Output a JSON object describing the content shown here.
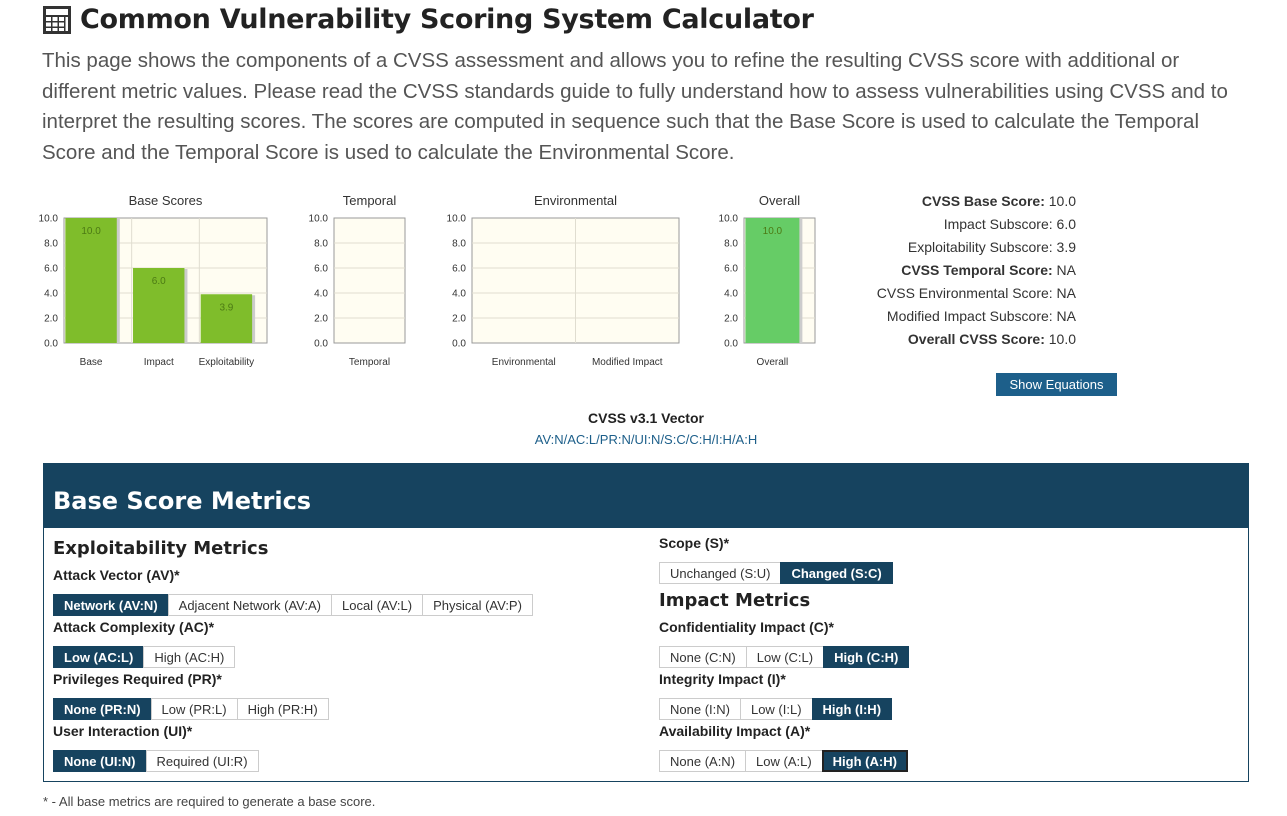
{
  "header": {
    "title": "Common Vulnerability Scoring System Calculator",
    "intro": "This page shows the components of a CVSS assessment and allows you to refine the resulting CVSS score with additional or different metric values. Please read the CVSS standards guide to fully understand how to assess vulnerabilities using CVSS and to interpret the resulting scores. The scores are computed in sequence such that the Base Score is used to calculate the Temporal Score and the Temporal Score is used to calculate the Environmental Score."
  },
  "chart_data": [
    {
      "type": "bar",
      "title": "Base Scores",
      "categories": [
        "Base",
        "Impact",
        "Exploitability"
      ],
      "values": [
        10.0,
        6.0,
        3.9
      ],
      "value_labels": [
        "10.0",
        "6.0",
        "3.9"
      ],
      "ylim": [
        0,
        10
      ],
      "yticks": [
        "0.0",
        "2.0",
        "4.0",
        "6.0",
        "8.0",
        "10.0"
      ],
      "color": "#7fbd2b"
    },
    {
      "type": "bar",
      "title": "Temporal",
      "categories": [
        "Temporal"
      ],
      "values": [
        null
      ],
      "ylim": [
        0,
        10
      ],
      "yticks": [
        "0.0",
        "2.0",
        "4.0",
        "6.0",
        "8.0",
        "10.0"
      ]
    },
    {
      "type": "bar",
      "title": "Environmental",
      "categories": [
        "Environmental",
        "Modified Impact"
      ],
      "values": [
        null,
        null
      ],
      "ylim": [
        0,
        10
      ],
      "yticks": [
        "0.0",
        "2.0",
        "4.0",
        "6.0",
        "8.0",
        "10.0"
      ]
    },
    {
      "type": "bar",
      "title": "Overall",
      "categories": [
        "Overall"
      ],
      "values": [
        10.0
      ],
      "value_labels": [
        "10.0"
      ],
      "ylim": [
        0,
        10
      ],
      "yticks": [
        "0.0",
        "2.0",
        "4.0",
        "6.0",
        "8.0",
        "10.0"
      ],
      "color": "#66cc66"
    }
  ],
  "summary": {
    "rows": [
      {
        "label": "CVSS Base Score:",
        "value": "10.0",
        "bold": true
      },
      {
        "label": "Impact Subscore:",
        "value": "6.0",
        "bold": false
      },
      {
        "label": "Exploitability Subscore:",
        "value": "3.9",
        "bold": false
      },
      {
        "label": "CVSS Temporal Score:",
        "value": "NA",
        "bold": true
      },
      {
        "label": "CVSS Environmental Score:",
        "value": "NA",
        "bold": false
      },
      {
        "label": "Modified Impact Subscore:",
        "value": "NA",
        "bold": false
      },
      {
        "label": "Overall CVSS Score:",
        "value": "10.0",
        "bold": true
      }
    ],
    "show_equations": "Show Equations"
  },
  "vector": {
    "title": "CVSS v3.1 Vector",
    "value": "AV:N/AC:L/PR:N/UI:N/S:C/C:H/I:H/A:H"
  },
  "metrics": {
    "panel_title": "Base Score Metrics",
    "exploitability_title": "Exploitability Metrics",
    "impact_title": "Impact Metrics",
    "av": {
      "label": "Attack Vector (AV)*",
      "options": [
        "Network (AV:N)",
        "Adjacent Network (AV:A)",
        "Local (AV:L)",
        "Physical (AV:P)"
      ],
      "selected": 0
    },
    "ac": {
      "label": "Attack Complexity (AC)*",
      "options": [
        "Low (AC:L)",
        "High (AC:H)"
      ],
      "selected": 0
    },
    "pr": {
      "label": "Privileges Required (PR)*",
      "options": [
        "None (PR:N)",
        "Low (PR:L)",
        "High (PR:H)"
      ],
      "selected": 0
    },
    "ui": {
      "label": "User Interaction (UI)*",
      "options": [
        "None (UI:N)",
        "Required (UI:R)"
      ],
      "selected": 0
    },
    "s": {
      "label": "Scope (S)*",
      "options": [
        "Unchanged (S:U)",
        "Changed (S:C)"
      ],
      "selected": 1
    },
    "c": {
      "label": "Confidentiality Impact (C)*",
      "options": [
        "None (C:N)",
        "Low (C:L)",
        "High (C:H)"
      ],
      "selected": 2
    },
    "i": {
      "label": "Integrity Impact (I)*",
      "options": [
        "None (I:N)",
        "Low (I:L)",
        "High (I:H)"
      ],
      "selected": 2
    },
    "a": {
      "label": "Availability Impact (A)*",
      "options": [
        "None (A:N)",
        "Low (A:L)",
        "High (A:H)"
      ],
      "selected": 2
    }
  },
  "footnote": "* - All base metrics are required to generate a base score."
}
